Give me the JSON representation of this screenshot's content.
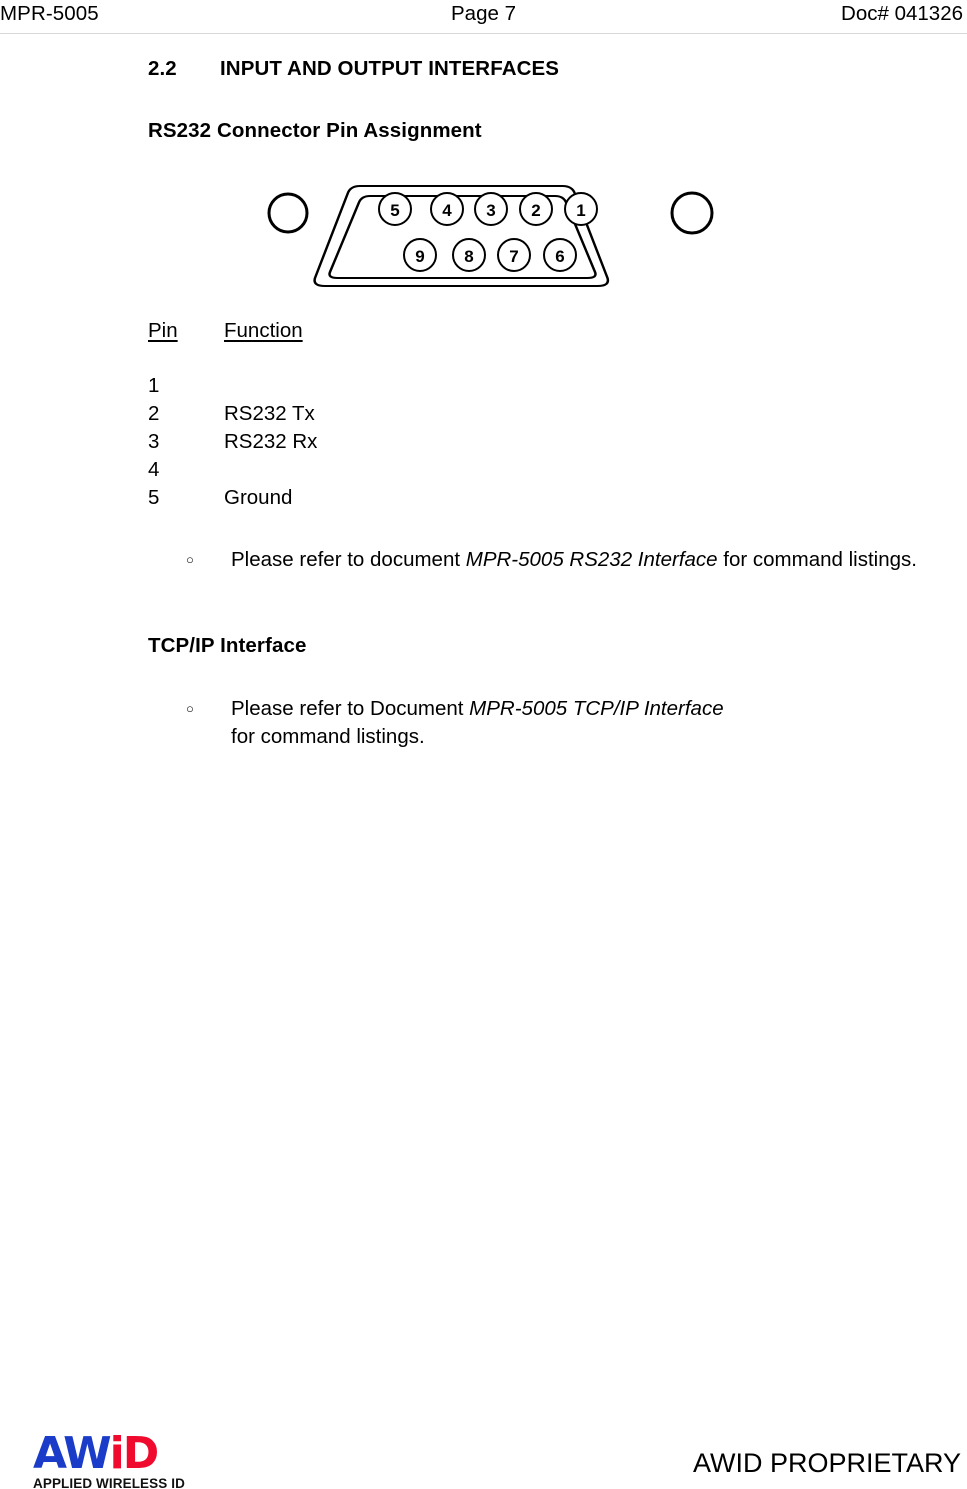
{
  "header": {
    "left": "MPR-5005",
    "center": "Page 7",
    "right": "Doc# 041326"
  },
  "headings": {
    "section_number": "2.2",
    "section_title": "INPUT AND OUTPUT INTERFACES",
    "subsection_rs232": "RS232 Connector Pin Assignment",
    "subsection_tcpip": "TCP/IP Interface"
  },
  "connector": {
    "type": "DB9 / D-sub 9-pin female connector face",
    "top_row_pins": [
      "5",
      "4",
      "3",
      "2",
      "1"
    ],
    "bottom_row_pins": [
      "9",
      "8",
      "7",
      "6"
    ],
    "mounting_holes": 2
  },
  "pin_table": {
    "headers": {
      "pin": "Pin",
      "function": "Function"
    },
    "rows": [
      {
        "pin": "1",
        "function": ""
      },
      {
        "pin": "2",
        "function": "RS232 Tx"
      },
      {
        "pin": "3",
        "function": "RS232 Rx"
      },
      {
        "pin": "4",
        "function": ""
      },
      {
        "pin": "5",
        "function": "Ground"
      }
    ]
  },
  "bullets": {
    "marker": "circle-bullet-icon",
    "rs232": {
      "prefix": "Please refer to document ",
      "italic": "MPR-5005 RS232 Interface",
      "suffix": " for command listings."
    },
    "tcpip": {
      "prefix": "Please refer to Document ",
      "italic": "MPR-5005 TCP/IP Interface",
      "suffix": " for command listings."
    }
  },
  "footer": {
    "logo_aw": "AW",
    "logo_id": "iD",
    "logo_tagline": "APPLIED WIRELESS ID",
    "proprietary": "AWID PROPRIETARY",
    "colors": {
      "logo_blue": "#1a3cc8",
      "logo_red": "#ef0a2e"
    }
  }
}
